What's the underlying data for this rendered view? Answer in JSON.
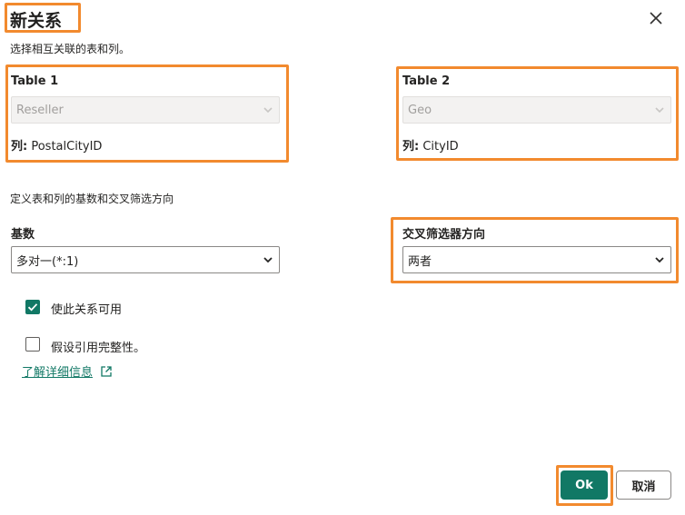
{
  "dialog": {
    "title": "新关系",
    "subtitle": "选择相互关联的表和列。"
  },
  "table1": {
    "heading": "Table 1",
    "selected": "Reseller",
    "column_label": "列:",
    "column_value": "PostalCityID"
  },
  "table2": {
    "heading": "Table 2",
    "selected": "Geo",
    "column_label": "列:",
    "column_value": "CityID"
  },
  "section": {
    "description": "定义表和列的基数和交叉筛选方向"
  },
  "cardinality": {
    "label": "基数",
    "selected": "多对一(*:1)"
  },
  "crossfilter": {
    "label": "交叉筛选器方向",
    "selected": "两者"
  },
  "options": {
    "activate_label": "使此关系可用",
    "activate_checked": true,
    "integrity_label": "假设引用完整性。",
    "integrity_checked": false
  },
  "learn_more": {
    "label": "了解详细信息"
  },
  "footer": {
    "ok_label": "Ok",
    "cancel_label": "取消"
  },
  "colors": {
    "accent": "#117865",
    "highlight": "#f28a2e"
  },
  "icons": {
    "close": "close-icon",
    "chevron": "chevron-down-icon",
    "external": "external-link-icon",
    "check": "checkmark-icon"
  }
}
